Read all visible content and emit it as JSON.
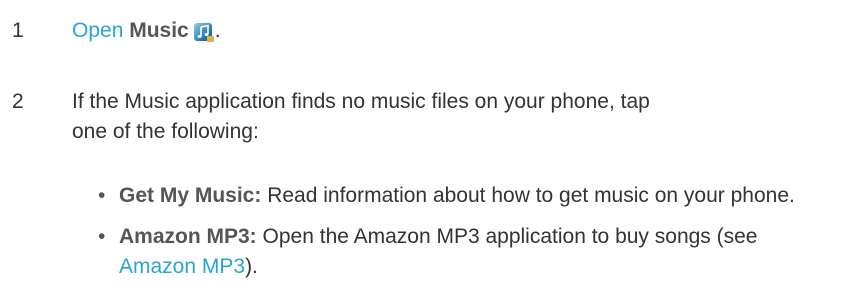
{
  "step1": {
    "number": "1",
    "link_text": "Open",
    "app_name": "Music",
    "icon": "music-app-icon",
    "trailing": "."
  },
  "step2": {
    "number": "2",
    "intro": "If the Music application finds no music files on your phone, tap one of the following:",
    "items": [
      {
        "title": "Get My Music:",
        "text": " Read information about how to get music on your phone."
      },
      {
        "title": "Amazon MP3:",
        "text_before": " Open the Amazon MP3 application to buy songs (see ",
        "link": "Amazon MP3",
        "text_after": ")."
      }
    ]
  },
  "colors": {
    "link": "#2aa3d8",
    "body_text": "#333333",
    "bold_text": "#555555"
  }
}
